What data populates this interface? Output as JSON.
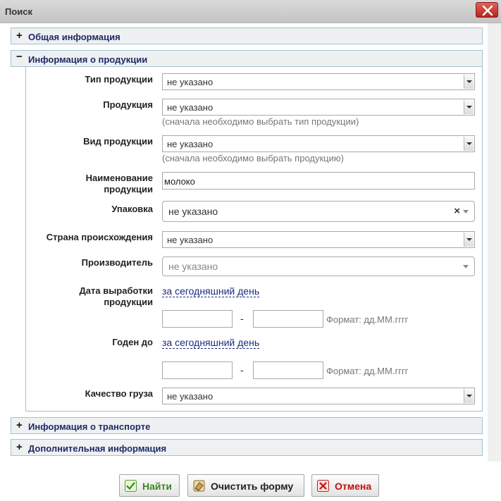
{
  "window": {
    "title": "Поиск",
    "close_icon": "close-icon"
  },
  "sections": {
    "general": {
      "sign": "+",
      "label": "Общая информация"
    },
    "product": {
      "sign": "−",
      "label": "Информация о продукции"
    },
    "transport": {
      "sign": "+",
      "label": "Информация о транспорте"
    },
    "additional": {
      "sign": "+",
      "label": "Дополнительная информация"
    }
  },
  "form": {
    "product_type": {
      "label": "Тип продукции",
      "value": "не указано"
    },
    "product": {
      "label": "Продукция",
      "value": "не указано",
      "hint": "(сначала необходимо выбрать тип продукции)"
    },
    "product_kind": {
      "label": "Вид продукции",
      "value": "не указано",
      "hint": "(сначала необходимо выбрать продукцию)"
    },
    "product_name": {
      "label_line1": "Наименование",
      "label_line2": "продукции",
      "value": "молоко"
    },
    "packaging": {
      "label": "Упаковка",
      "value": "не указано",
      "clear": "×"
    },
    "origin_country": {
      "label": "Страна происхождения",
      "value": "не указано"
    },
    "manufacturer": {
      "label": "Производитель",
      "placeholder": "не указано"
    },
    "production_date": {
      "label_line1": "Дата выработки",
      "label_line2": "продукции",
      "today_link": "за сегодняшний день",
      "separator": "-",
      "format_hint": "Формат: дд.ММ.гггг",
      "from_value": "",
      "to_value": ""
    },
    "expiry": {
      "label": "Годен до",
      "today_link": "за сегодняшний день",
      "separator": "-",
      "format_hint": "Формат: дд.ММ.гггг",
      "from_value": "",
      "to_value": ""
    },
    "cargo_quality": {
      "label": "Качество груза",
      "value": "не указано"
    }
  },
  "buttons": {
    "find": {
      "label": "Найти",
      "icon": "check-icon",
      "color": "#3a8a1e"
    },
    "clear": {
      "label": "Очистить форму",
      "icon": "eraser-icon",
      "color": "#222222"
    },
    "cancel": {
      "label": "Отмена",
      "icon": "cross-icon",
      "color": "#c01010"
    }
  }
}
